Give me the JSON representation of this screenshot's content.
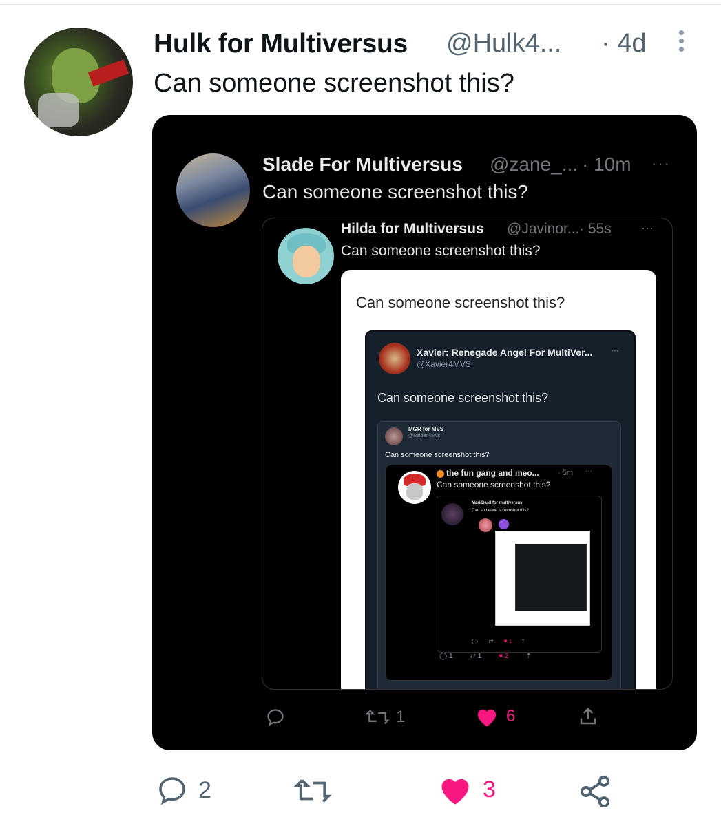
{
  "post": {
    "author_name": "Hulk for Multiversus",
    "author_handle": "@Hulk4...",
    "time": "· 4d",
    "text": "Can someone screenshot this?",
    "actions": {
      "replies": "2",
      "retweets": "",
      "likes": "3"
    }
  },
  "quote1": {
    "author_name": "Slade For Multiversus",
    "author_handle": "@zane_...",
    "time": "· 10m",
    "more": "···",
    "text": "Can someone screenshot this?",
    "actions": {
      "retweets": "1",
      "likes": "6"
    }
  },
  "quote2": {
    "author_name": "Hilda for Multiversus",
    "author_handle": "@Javinor...",
    "time": "· 55s",
    "more": "···",
    "text": "Can someone screenshot this?",
    "image_text": "Can someone screenshot this?"
  },
  "quote3": {
    "author_name": "Xavier: Renegade Angel For MultiVer...",
    "author_handle": "@Xavier4MVS",
    "more": "···",
    "text": "Can someone screenshot this?"
  },
  "quote4": {
    "author_name": "MGR for MVS",
    "author_handle": "@Raiden4Mvs",
    "text": "Can someone screenshot this?"
  },
  "quote5": {
    "author_name": "the fun gang and meo...",
    "time": "· 5m",
    "more": "···",
    "text": "Can someone screenshot this?",
    "actions": {
      "replies": "1",
      "retweets": "1",
      "likes": "2"
    }
  },
  "quote6": {
    "author_name": "Mari/Basil for multiversus",
    "text": "Can someone screenshot this?",
    "actions": {
      "likes": "1"
    }
  },
  "colors": {
    "background": "#ffffff",
    "media_bg": "#000000",
    "like_pink": "#f91880",
    "muted": "#536471"
  },
  "icons": [
    "more-vertical-icon",
    "reply-icon",
    "retweet-icon",
    "heart-icon",
    "share-icon"
  ]
}
